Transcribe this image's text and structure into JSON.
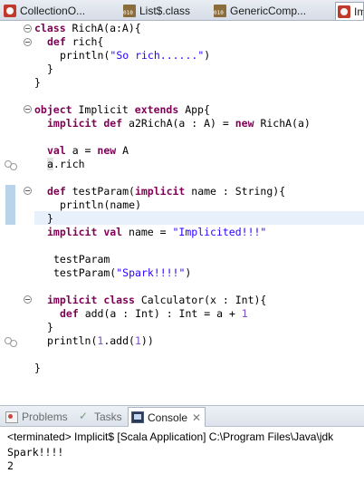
{
  "editor_tabs": [
    {
      "label": "CollectionO...",
      "icon": "scala-object-icon"
    },
    {
      "label": "List$.class",
      "icon": "class-file-icon"
    },
    {
      "label": "GenericComp...",
      "icon": "class-file-icon"
    },
    {
      "label": "Im",
      "icon": "scala-object-icon"
    }
  ],
  "code": {
    "l1": {
      "kw": "class",
      "rest": " RichA(a:A){"
    },
    "l2": {
      "kw": "def",
      "rest": " rich{"
    },
    "l3": {
      "pre": "println(",
      "str": "\"So rich......\"",
      "post": ")"
    },
    "l4": "}",
    "l5": "}",
    "l6": {
      "kw1": "object",
      "mid": " Implicit ",
      "kw2": "extends",
      "rest": " App{"
    },
    "l7": {
      "kw1": "implicit",
      "kw2": "def",
      "mid": " a2RichA(a : A) = ",
      "kw3": "new",
      "rest": " RichA(a)"
    },
    "l8": {
      "kw1": "val",
      "mid": " a = ",
      "kw2": "new",
      "rest": " A"
    },
    "l9": "a.rich",
    "l10": {
      "kw1": "def",
      "mid": " testParam(",
      "kw2": "implicit",
      "rest": " name : String){"
    },
    "l11": "println(name)",
    "l12": "}",
    "l13": {
      "kw1": "implicit",
      "kw2": "val",
      "mid": " name = ",
      "str": "\"Implicited!!!\""
    },
    "l14": "testParam",
    "l15": {
      "pre": "testParam(",
      "str": "\"Spark!!!!\"",
      "post": ")"
    },
    "l16": {
      "kw1": "implicit",
      "kw2": "class",
      "rest": " Calculator(x : Int){"
    },
    "l17": {
      "kw": "def",
      "mid": " add(a : Int) : Int = a + ",
      "num": "1"
    },
    "l18": "}",
    "l19": {
      "pre": "println(",
      "num1": "1",
      "mid": ".add(",
      "num2": "1",
      "post": "))"
    },
    "l20": "}"
  },
  "views": {
    "problems": "Problems",
    "tasks": "Tasks",
    "console": "Console",
    "close": "✕"
  },
  "console": {
    "header": "<terminated> Implicit$ [Scala Application] C:\\Program Files\\Java\\jdk",
    "lines": [
      "Spark!!!!",
      "2"
    ]
  }
}
